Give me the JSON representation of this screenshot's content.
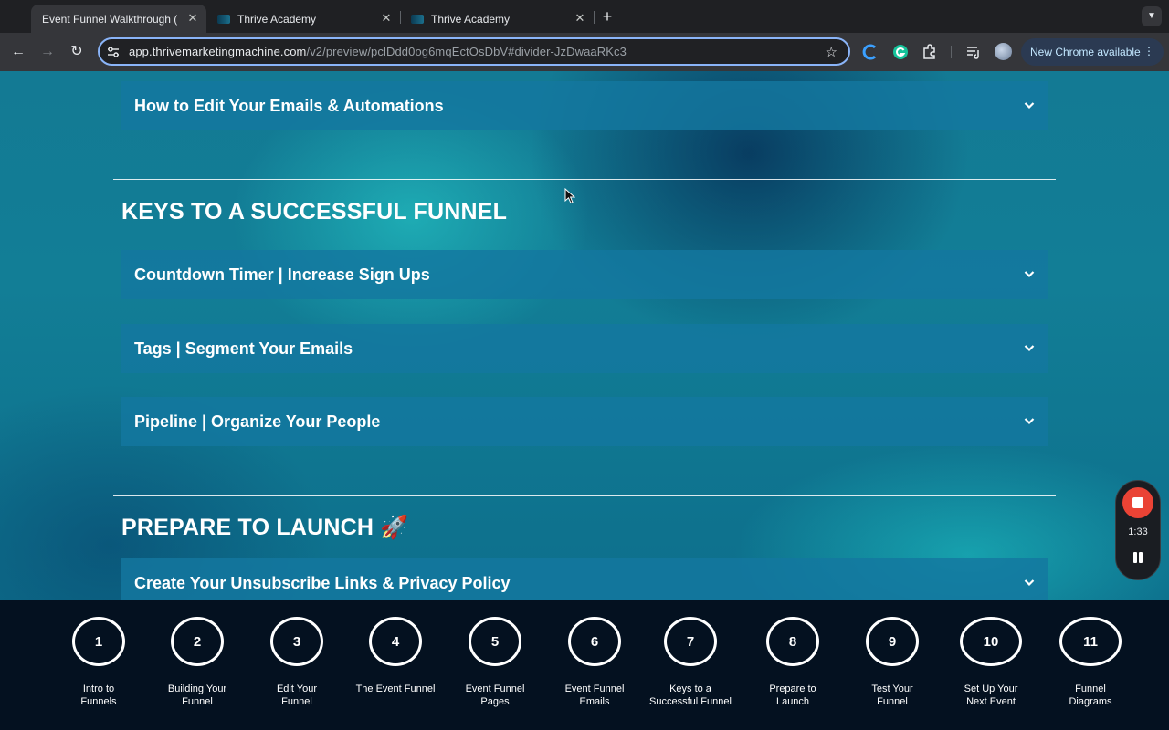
{
  "browser": {
    "tabs": [
      {
        "title": "Event Funnel Walkthrough (S",
        "active": true
      },
      {
        "title": "Thrive Academy",
        "active": false
      },
      {
        "title": "Thrive Academy",
        "active": false
      }
    ],
    "url_host": "app.thrivemarketingmachine.com",
    "url_path": "/v2/preview/pclDdd0og6mqEctOsDbV#divider-JzDwaaRKc3",
    "update_label": "New Chrome available"
  },
  "page": {
    "accordions_top": [
      {
        "label": "How to Edit Your Emails & Automations"
      }
    ],
    "sections": [
      {
        "title": "KEYS TO A SUCCESSFUL FUNNEL",
        "items": [
          {
            "label": "Countdown Timer | Increase Sign Ups"
          },
          {
            "label": "Tags | Segment Your Emails"
          },
          {
            "label": "Pipeline | Organize Your People"
          }
        ]
      },
      {
        "title": "PREPARE TO LAUNCH 🚀",
        "items": [
          {
            "label": "Create Your Unsubscribe Links & Privacy Policy"
          }
        ]
      }
    ]
  },
  "recorder": {
    "time": "1:33"
  },
  "steps": [
    {
      "num": "1",
      "line1": "Intro to",
      "line2": "Funnels"
    },
    {
      "num": "2",
      "line1": "Building Your",
      "line2": "Funnel"
    },
    {
      "num": "3",
      "line1": "Edit Your",
      "line2": "Funnel"
    },
    {
      "num": "4",
      "line1": "The Event Funnel",
      "line2": ""
    },
    {
      "num": "5",
      "line1": "Event Funnel",
      "line2": "Pages"
    },
    {
      "num": "6",
      "line1": "Event Funnel",
      "line2": "Emails"
    },
    {
      "num": "7",
      "line1": "Keys to a",
      "line2": "Successful Funnel"
    },
    {
      "num": "8",
      "line1": "Prepare to",
      "line2": "Launch"
    },
    {
      "num": "9",
      "line1": "Test Your",
      "line2": "Funnel"
    },
    {
      "num": "10",
      "line1": "Set Up Your",
      "line2": "Next Event"
    },
    {
      "num": "11",
      "line1": "Funnel",
      "line2": "Diagrams"
    }
  ]
}
